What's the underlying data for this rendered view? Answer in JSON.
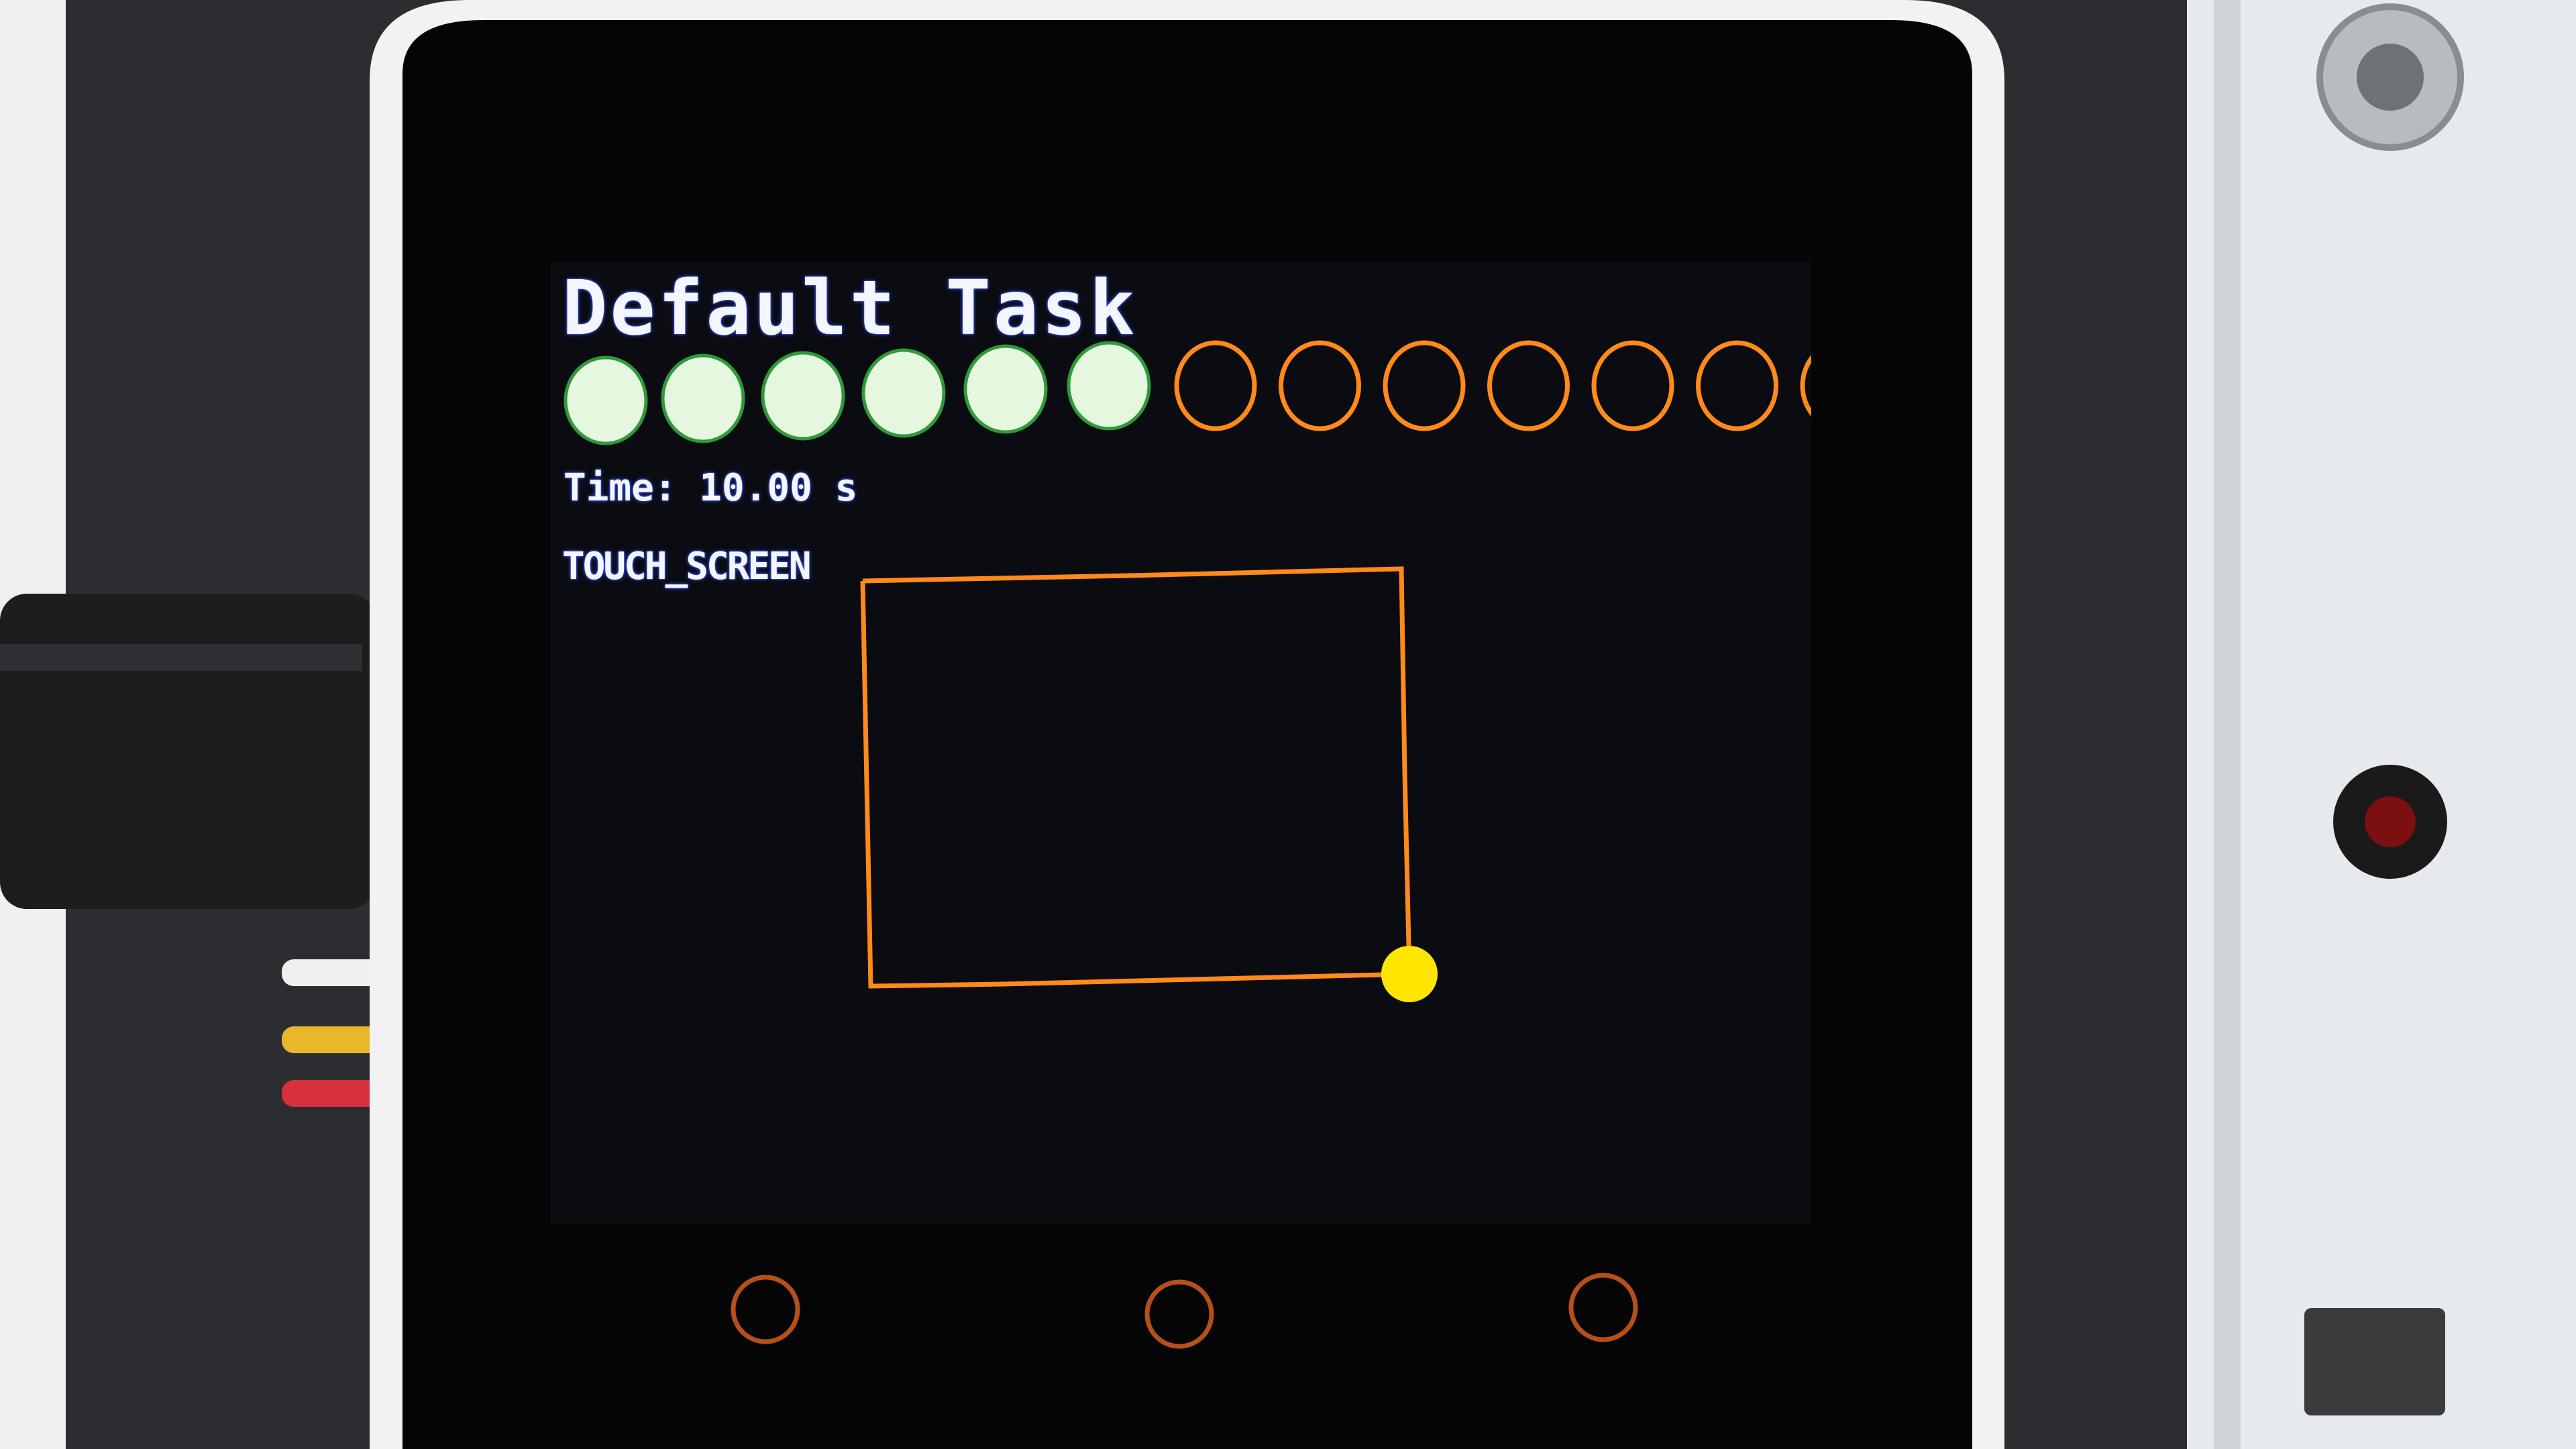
{
  "screen": {
    "title": "Default Task",
    "time_label": "Time: 10.00 s",
    "touch_label": "TOUCH_SCREEN"
  },
  "progress": {
    "total_dots": 13,
    "completed_dots": 6,
    "completed_color": "#e6f7df",
    "completed_edge_color": "#2f9a3a",
    "pending_color": "#ff8a1a"
  },
  "touch_trace": {
    "line_color": "#ff8a1a",
    "cursor_color": "#ffe600"
  },
  "bottom_buttons": [
    {
      "name": "button-a"
    },
    {
      "name": "button-b"
    },
    {
      "name": "button-c"
    }
  ],
  "colors": {
    "display_bg": "#0b0c12",
    "bezel": "#050505",
    "frame": "#f2f2f2",
    "button_ring": "#b5501a"
  }
}
